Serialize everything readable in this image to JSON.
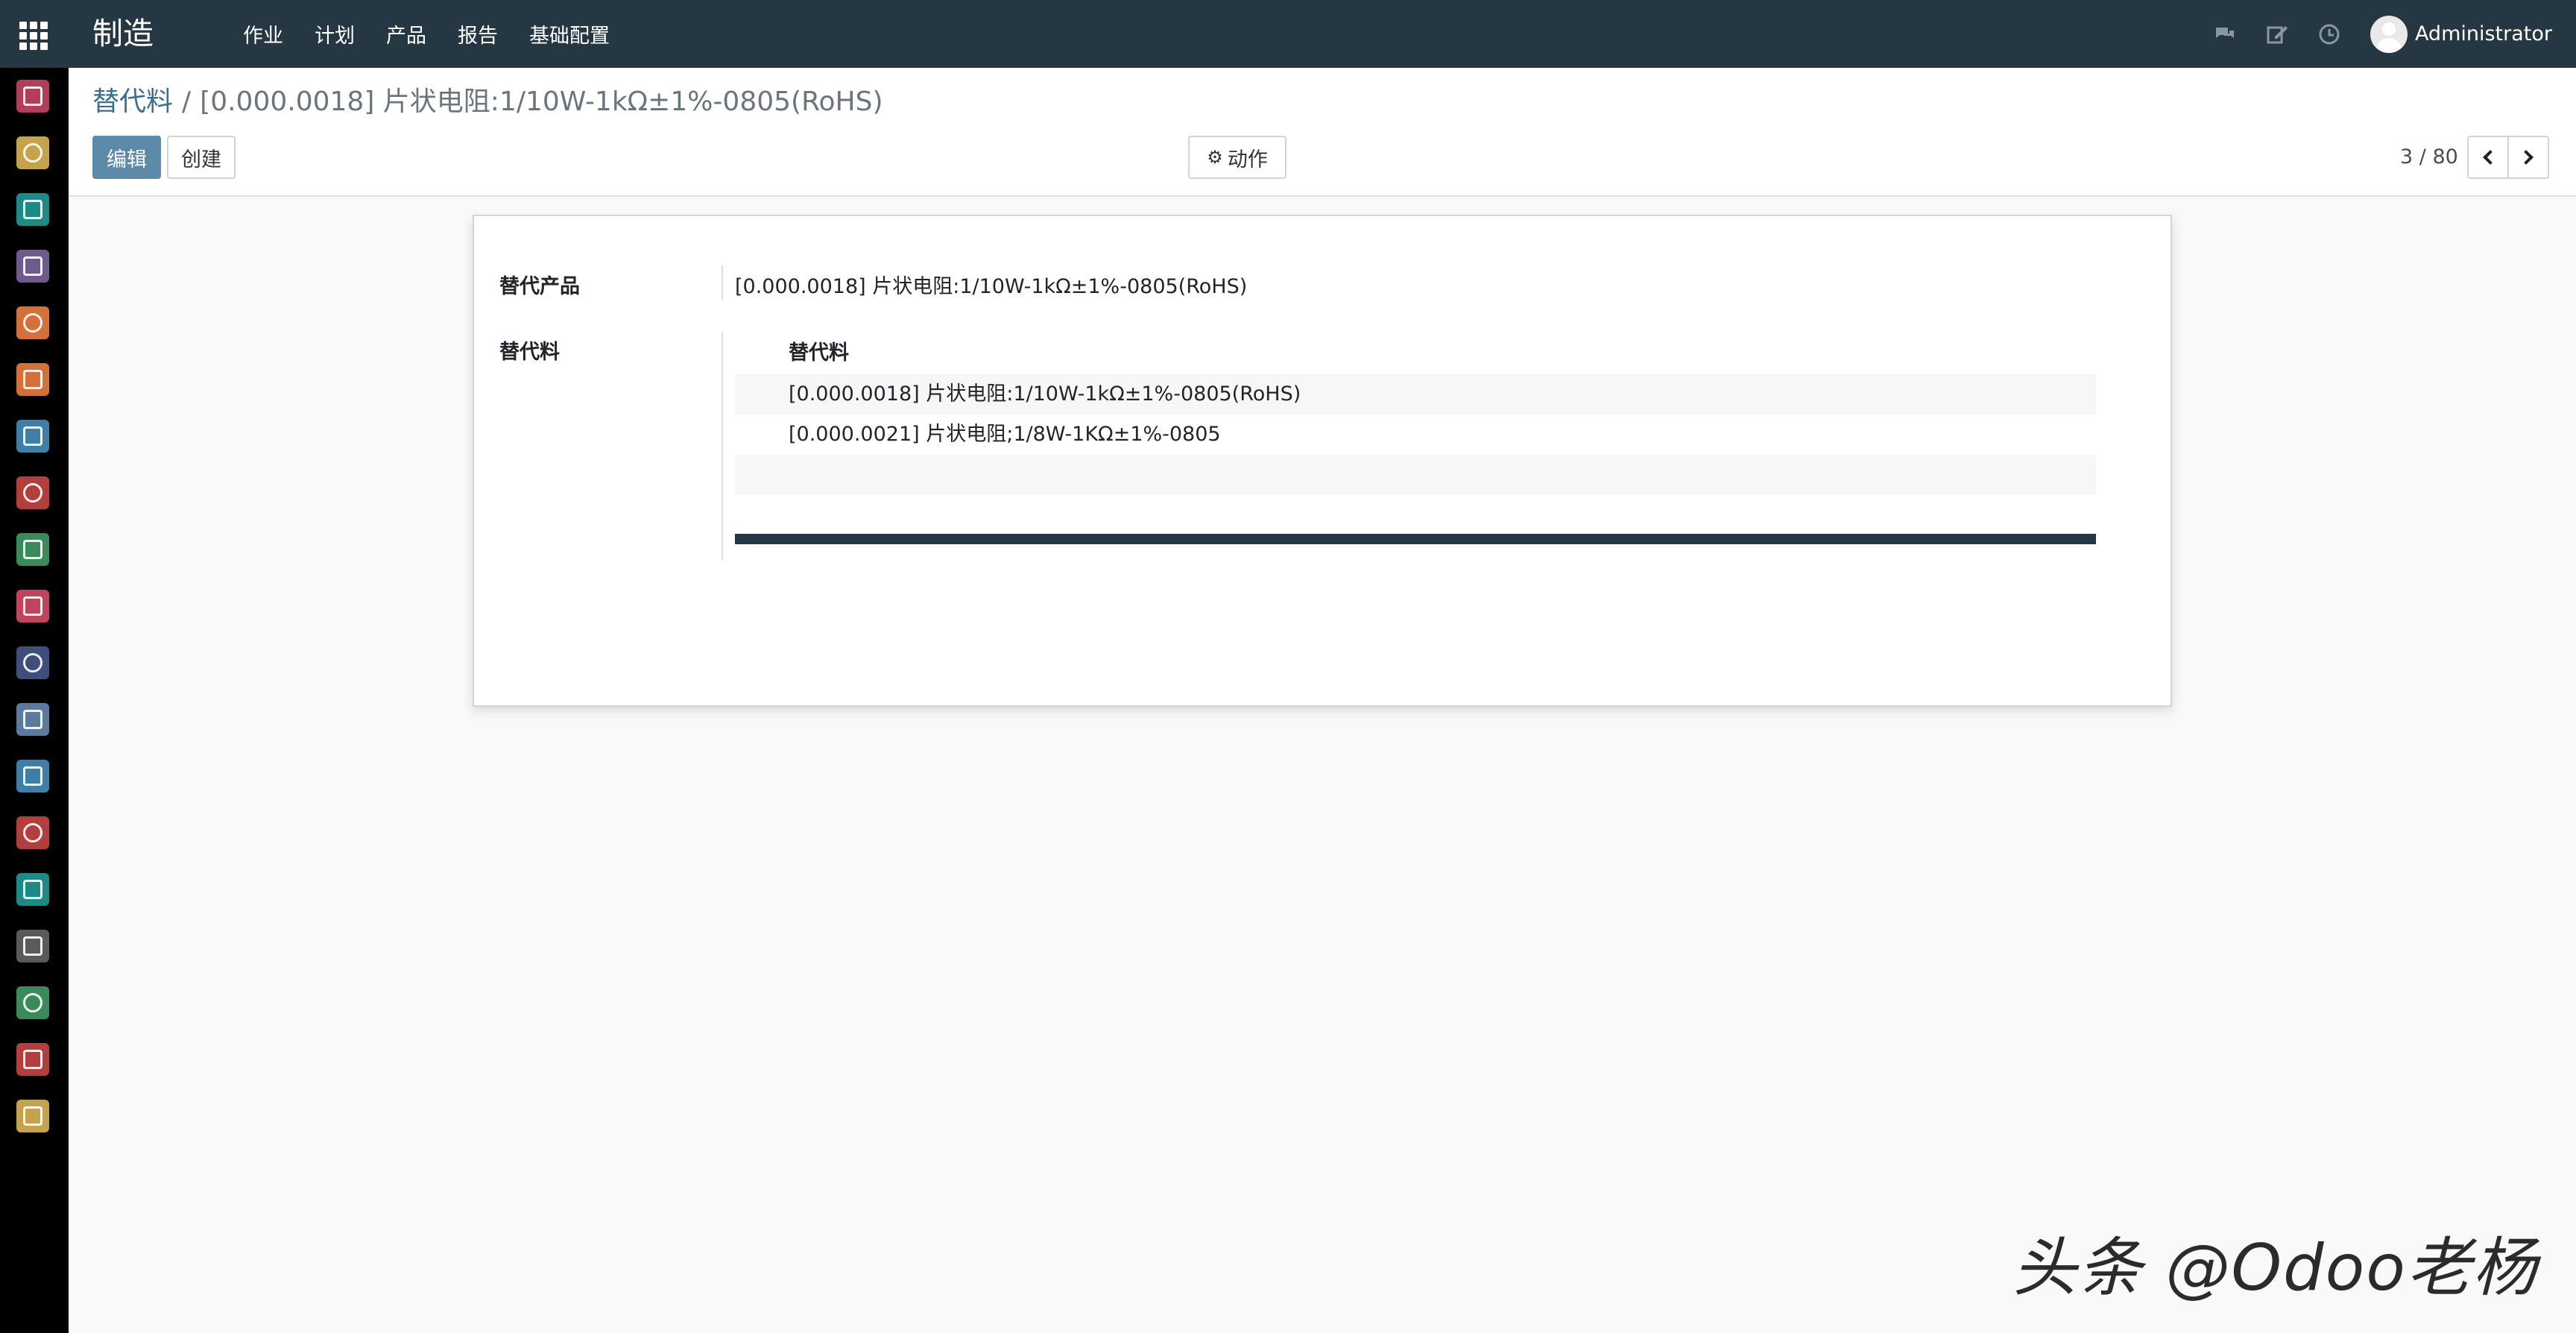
{
  "navbar": {
    "brand": "制造",
    "menu": [
      "作业",
      "计划",
      "产品",
      "报告",
      "基础配置"
    ],
    "user": "Administrator",
    "icons": [
      "apps-icon",
      "chat-icon",
      "edit-activity-icon",
      "clock-icon",
      "avatar"
    ]
  },
  "sidebar": {
    "apps": [
      {
        "name": "discuss-app-icon",
        "color": "#b23e5a"
      },
      {
        "name": "calendar-app-icon",
        "color": "#c4a34c"
      },
      {
        "name": "contacts-app-icon",
        "color": "#1c8a86"
      },
      {
        "name": "crm-app-icon",
        "color": "#6e5b8c"
      },
      {
        "name": "sales-app-icon",
        "color": "#d5703a"
      },
      {
        "name": "website-app-icon",
        "color": "#d5703a"
      },
      {
        "name": "invoicing-app-icon",
        "color": "#3d7fa6"
      },
      {
        "name": "inventory-app-icon",
        "color": "#b33f3c"
      },
      {
        "name": "repair-app-icon",
        "color": "#3a8a5a"
      },
      {
        "name": "documents-app-icon",
        "color": "#c0445e"
      },
      {
        "name": "apps-puzzle-icon",
        "color": "#3d4f7a"
      },
      {
        "name": "manufacturing-app-icon",
        "color": "#5b7a9c"
      },
      {
        "name": "quality-app-icon",
        "color": "#3d7fa6"
      },
      {
        "name": "timesheet-app-icon",
        "color": "#b23e3e"
      },
      {
        "name": "employees-app-icon",
        "color": "#1c8a86"
      },
      {
        "name": "expenses-app-icon",
        "color": "#5a5a5a"
      },
      {
        "name": "attendance-app-icon",
        "color": "#3a8a5a"
      },
      {
        "name": "recruitment-app-icon",
        "color": "#b23e3e"
      },
      {
        "name": "settings-app-icon",
        "color": "#c4a34c"
      }
    ]
  },
  "control_panel": {
    "breadcrumb_parent": "替代料",
    "breadcrumb_separator": "/",
    "breadcrumb_current": "[0.000.0018] 片状电阻:1/10W-1kΩ±1%-0805(RoHS)",
    "edit_label": "编辑",
    "create_label": "创建",
    "action_label": "动作",
    "pager_value": "3 / 80"
  },
  "form": {
    "product_label": "替代产品",
    "product_value": "[0.000.0018] 片状电阻:1/10W-1kΩ±1%-0805(RoHS)",
    "substitutes_label": "替代料",
    "table_header": "替代料",
    "rows": [
      "[0.000.0018] 片状电阻:1/10W-1kΩ±1%-0805(RoHS)",
      "[0.000.0021] 片状电阻;1/8W-1KΩ±1%-0805"
    ]
  },
  "watermark": "头条 @Odoo老杨",
  "colors": {
    "navbar": "#243742",
    "accent": "#5d8aa8",
    "link": "#3c6f8c"
  }
}
